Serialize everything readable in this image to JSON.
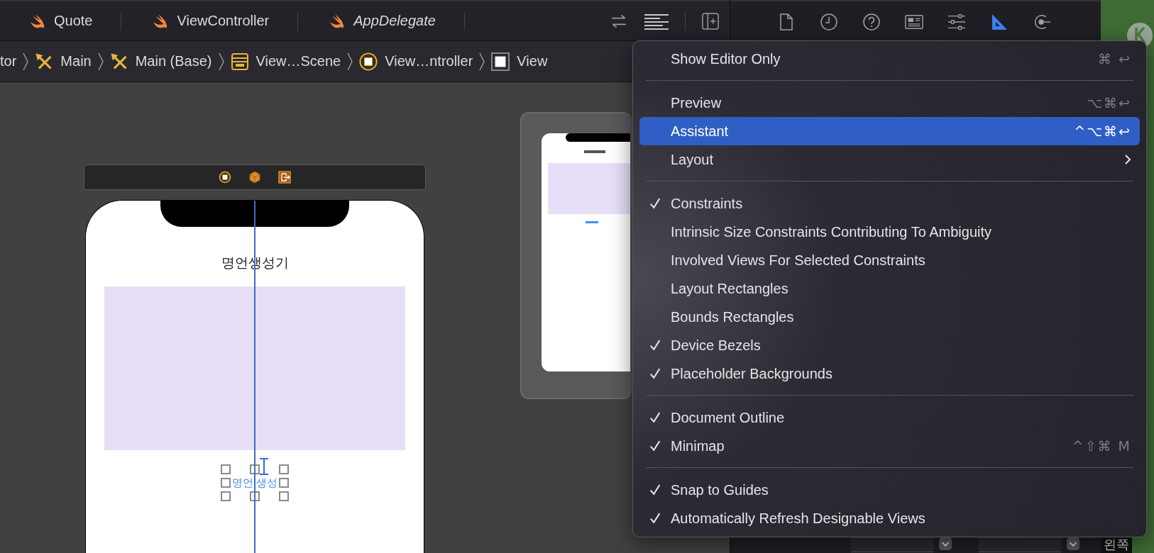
{
  "editor_tabs": [
    {
      "label": "Quote",
      "italic": false
    },
    {
      "label": "ViewController",
      "italic": false
    },
    {
      "label": "AppDelegate",
      "italic": true
    }
  ],
  "editor_tools": [
    {
      "kind": "swap",
      "selected": false
    },
    {
      "kind": "options",
      "selected": true
    },
    {
      "kind": "add",
      "selected": false
    }
  ],
  "breadcrumbs": [
    {
      "label": "tor",
      "kind": "text"
    },
    {
      "label": "Main",
      "kind": "storyboard"
    },
    {
      "label": "Main (Base)",
      "kind": "storyboard"
    },
    {
      "label": "View…Scene",
      "kind": "scene"
    },
    {
      "label": "View…ntroller",
      "kind": "controller"
    },
    {
      "label": "View",
      "kind": "view"
    }
  ],
  "inspector_tabs": [
    {
      "kind": "file",
      "selected": false
    },
    {
      "kind": "history",
      "selected": false
    },
    {
      "kind": "help",
      "selected": false
    },
    {
      "kind": "identity",
      "selected": false
    },
    {
      "kind": "attributes",
      "selected": false
    },
    {
      "kind": "size",
      "selected": true
    },
    {
      "kind": "connections",
      "selected": false
    }
  ],
  "inspector_label": "왼쪽",
  "scene": {
    "title": "명언생성기",
    "button": "명언 생성"
  },
  "menu": {
    "items": [
      {
        "kind": "item",
        "label": "Show Editor Only",
        "checked": false,
        "highlighted": false,
        "shortcut": "⌘ ↩"
      },
      {
        "kind": "separator"
      },
      {
        "kind": "item",
        "label": "Preview",
        "checked": false,
        "highlighted": false,
        "shortcut": "⌥⌘↩"
      },
      {
        "kind": "item",
        "label": "Assistant",
        "checked": false,
        "highlighted": true,
        "shortcut": "^⌥⌘↩"
      },
      {
        "kind": "submenu",
        "label": "Layout",
        "checked": false,
        "highlighted": false
      },
      {
        "kind": "separator"
      },
      {
        "kind": "item",
        "label": "Constraints",
        "checked": true,
        "highlighted": false
      },
      {
        "kind": "item",
        "label": "Intrinsic Size Constraints Contributing To Ambiguity",
        "checked": false,
        "highlighted": false
      },
      {
        "kind": "item",
        "label": "Involved Views For Selected Constraints",
        "checked": false,
        "highlighted": false
      },
      {
        "kind": "item",
        "label": "Layout Rectangles",
        "checked": false,
        "highlighted": false
      },
      {
        "kind": "item",
        "label": "Bounds Rectangles",
        "checked": false,
        "highlighted": false
      },
      {
        "kind": "item",
        "label": "Device Bezels",
        "checked": true,
        "highlighted": false
      },
      {
        "kind": "item",
        "label": "Placeholder Backgrounds",
        "checked": true,
        "highlighted": false
      },
      {
        "kind": "separator"
      },
      {
        "kind": "item",
        "label": "Document Outline",
        "checked": true,
        "highlighted": false
      },
      {
        "kind": "item",
        "label": "Minimap",
        "checked": true,
        "highlighted": false,
        "shortcut": "^⇧⌘ M"
      },
      {
        "kind": "separator"
      },
      {
        "kind": "item",
        "label": "Snap to Guides",
        "checked": true,
        "highlighted": false
      },
      {
        "kind": "item",
        "label": "Automatically Refresh Designable Views",
        "checked": true,
        "highlighted": false
      }
    ]
  }
}
